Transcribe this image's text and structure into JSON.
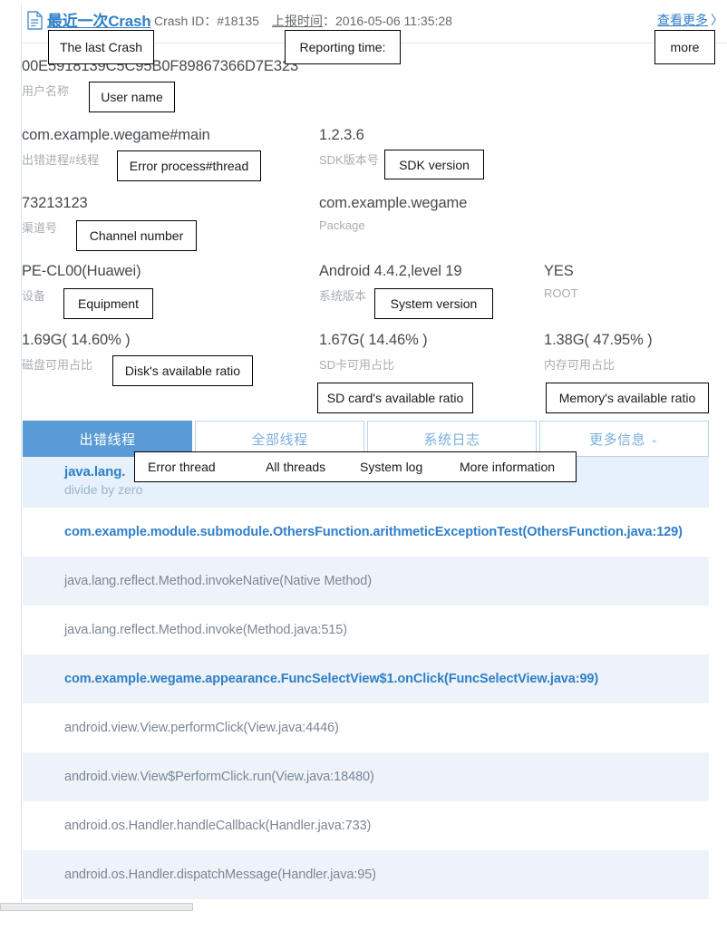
{
  "header": {
    "doc_icon": "document-icon",
    "title": "最近一次Crash",
    "crash_id": "Crash ID：#18135",
    "report_time_label": "上报时间",
    "report_time": "：2016-05-06 11:35:28",
    "view_more": "查看更多",
    "view_more_chevron": "〉"
  },
  "fields": {
    "user": {
      "value": "00E5918139C5C95B0F89867366D7E323",
      "label": "用户名称"
    },
    "process": {
      "value": "com.example.wegame#main",
      "label": "出错进程#线程"
    },
    "sdk": {
      "value": "1.2.3.6",
      "label": "SDK版本号"
    },
    "channel": {
      "value": "73213123",
      "label": "渠道号"
    },
    "package": {
      "value": "com.example.wegame",
      "label": "Package"
    },
    "device": {
      "value": "PE-CL00(Huawei)",
      "label": "设备"
    },
    "system": {
      "value": "Android 4.4.2,level 19",
      "label": "系统版本"
    },
    "root": {
      "value": "YES",
      "label": "ROOT"
    },
    "disk": {
      "value": "1.69G( 14.60% )",
      "label": "磁盘可用占比"
    },
    "sdcard": {
      "value": "1.67G( 14.46% )",
      "label": "SD卡可用占比"
    },
    "memory": {
      "value": "1.38G( 47.95% )",
      "label": "内存可用占比"
    }
  },
  "tabs": [
    {
      "label": "出错线程",
      "active": true,
      "caret": ""
    },
    {
      "label": "全部线程",
      "active": false,
      "caret": ""
    },
    {
      "label": "系统日志",
      "active": false,
      "caret": ""
    },
    {
      "label": "更多信息",
      "active": false,
      "caret": "⌄"
    }
  ],
  "exception": {
    "name": "java.lang.",
    "message": "divide by zero"
  },
  "stack_rows": [
    {
      "text": "com.example.module.submodule.OthersFunction.arithmeticExceptionTest(OthersFunction.java:129)",
      "highlight": true,
      "alt": false
    },
    {
      "text": "java.lang.reflect.Method.invokeNative(Native Method)",
      "highlight": false,
      "alt": true
    },
    {
      "text": "java.lang.reflect.Method.invoke(Method.java:515)",
      "highlight": false,
      "alt": false
    },
    {
      "text": "com.example.wegame.appearance.FuncSelectView$1.onClick(FuncSelectView.java:99)",
      "highlight": true,
      "alt": true
    },
    {
      "text": "android.view.View.performClick(View.java:4446)",
      "highlight": false,
      "alt": false
    },
    {
      "text": "android.view.View$PerformClick.run(View.java:18480)",
      "highlight": false,
      "alt": true
    },
    {
      "text": "android.os.Handler.handleCallback(Handler.java:733)",
      "highlight": false,
      "alt": false
    },
    {
      "text": "android.os.Handler.dispatchMessage(Handler.java:95)",
      "highlight": false,
      "alt": true
    }
  ],
  "callouts": {
    "last_crash": "The last Crash",
    "reporting_time": "Reporting time:",
    "more": "more",
    "user_name": "User name",
    "error_process": "Error process#thread",
    "sdk_version": "SDK version",
    "channel_number": "Channel number",
    "equipment": "Equipment",
    "system_version": "System version",
    "disk_ratio": "Disk's available ratio",
    "sdcard_ratio": "SD card's available ratio",
    "memory_ratio": "Memory's available ratio",
    "tab_error_thread": "Error thread",
    "tab_all_threads": "All threads",
    "tab_system_log": "System log",
    "tab_more_info": "More information"
  },
  "colors": {
    "accent_blue": "#2f7fc8",
    "tab_active_bg": "#5b9bd5",
    "tab_border": "#b8d4ec",
    "row_alt_bg": "#eef3fa",
    "exception_bg": "#e6f1fb",
    "label_gray": "#a8adb3"
  }
}
